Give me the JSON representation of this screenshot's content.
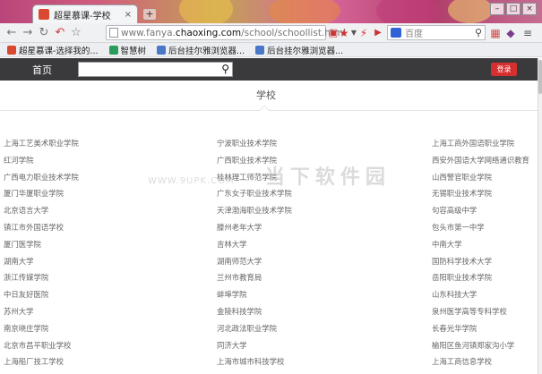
{
  "browser": {
    "tab_title": "超星慕课-学校",
    "tab_close": "×",
    "new_tab": "+",
    "window_controls": [
      "–",
      "□",
      "×"
    ],
    "url": {
      "prefix": "www.fanya.",
      "host": "chaoxing.com",
      "path": "/school/schoollist.html"
    },
    "search_placeholder": "百度",
    "bookmarks": [
      {
        "label": "超星慕课-选择我的...",
        "icon_color": "#d8492f"
      },
      {
        "label": "智慧树",
        "icon_color": "#2a9c5b"
      },
      {
        "label": "后台挂尔雅浏览器...",
        "icon_color": "#4a78c8"
      },
      {
        "label": "后台挂尔雅浏览器...",
        "icon_color": "#4a78c8"
      }
    ]
  },
  "site": {
    "home_label": "首页",
    "login_label": "登录",
    "page_title": "学校"
  },
  "schools": [
    [
      "上海工艺美术职业学院",
      "宁波职业技术学院",
      "上海工商外国语职业学院"
    ],
    [
      "红河学院",
      "广西职业技术学院",
      "西安外国语大学网络通识教育"
    ],
    [
      "广西电力职业技术学院",
      "桂林理工师范学院",
      "山西警官职业学院"
    ],
    [
      "厦门华厦职业学院",
      "广东女子职业技术学院",
      "无锡职业技术学院"
    ],
    [
      "北京语言大学",
      "天津渤海职业技术学院",
      "句容高级中学"
    ],
    [
      "镇江市外国语学校",
      "滕州老年大学",
      "包头市第一中学"
    ],
    [
      "厦门医学院",
      "吉林大学",
      "中南大学"
    ],
    [
      "湖南大学",
      "湖南师范大学",
      "国防科学技术大学"
    ],
    [
      "浙江传媒学院",
      "兰州市教育局",
      "岳阳职业技术学院"
    ],
    [
      "中日友好医院",
      "蚌埠学院",
      "山东科技大学"
    ],
    [
      "苏州大学",
      "金陵科技学院",
      "泉州医学高等专科学校"
    ],
    [
      "南京晓庄学院",
      "河北政法职业学院",
      "长春光华学院"
    ],
    [
      "北京市昌平职业学校",
      "同济大学",
      "榆阳区鱼河镇郑家沟小学"
    ],
    [
      "上海船厂技工学校",
      "上海市城市科技学校",
      "上海工商信息学校"
    ]
  ],
  "watermark": {
    "url": "WWW.9UPK.COM",
    "text": "当下软件园"
  },
  "colors": {
    "header_bg": "#3a3a3c",
    "login_red": "#d62f2f",
    "link_gray": "#666666"
  }
}
